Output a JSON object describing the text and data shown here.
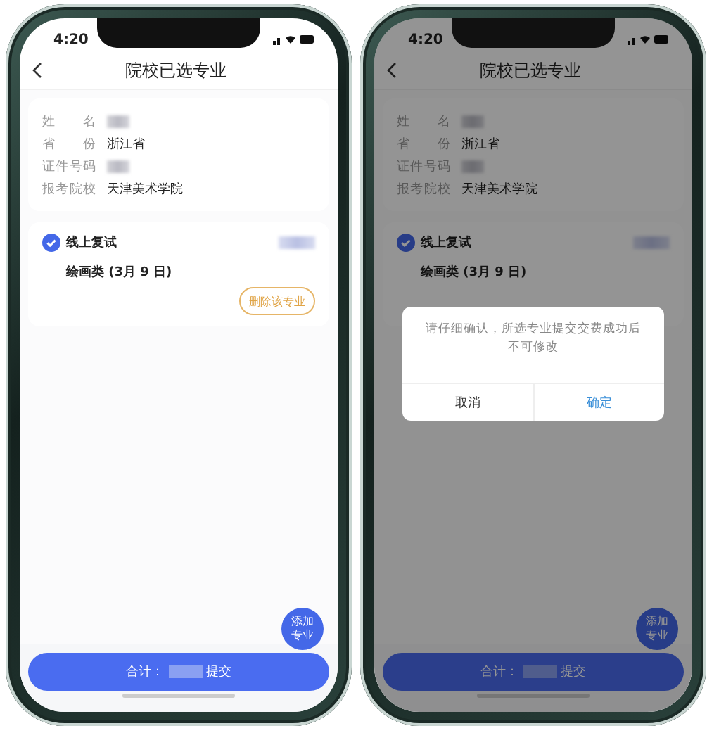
{
  "phones": [
    {
      "status_time": "4:20",
      "title": "院校已选专业",
      "info": [
        {
          "label": "姓名",
          "kind": "redacted"
        },
        {
          "label": "省份",
          "kind": "text",
          "value": "浙江省"
        },
        {
          "label": "证件号码",
          "kind": "redacted"
        },
        {
          "label": "报考院校",
          "kind": "text",
          "value": "天津美术学院"
        }
      ],
      "majors": [
        {
          "name": "线上复试",
          "checked": true,
          "detail": "绘画类 (3月 9 日)",
          "action": "删除该专业"
        }
      ],
      "fab": "添加专业",
      "submit": {
        "prefix": "合计：",
        "action": "提交"
      }
    },
    {
      "status_time": "4:20",
      "title": "院校已选专业",
      "info": [
        {
          "label": "姓名",
          "kind": "redacted"
        },
        {
          "label": "省份",
          "kind": "text",
          "value": "浙江省"
        },
        {
          "label": "证件号码",
          "kind": "redacted"
        },
        {
          "label": "报考院校",
          "kind": "text",
          "value": "天津美术学院"
        }
      ],
      "majors": [
        {
          "name": "线上复试",
          "checked": true,
          "detail": "绘画类 (3月 9 日)"
        }
      ],
      "fab": "添加专业",
      "submit": {
        "prefix": "合计：",
        "action": "提交"
      },
      "dialog": {
        "message": "请仔细确认，所选专业提交交费成功后不可修改",
        "cancel": "取消",
        "confirm": "确定"
      }
    }
  ]
}
